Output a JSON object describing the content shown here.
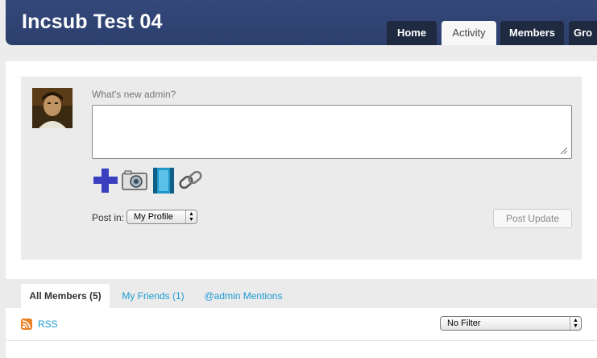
{
  "site": {
    "title": "Incsub Test 04"
  },
  "nav": {
    "tabs": [
      {
        "label": "Home"
      },
      {
        "label": "Activity"
      },
      {
        "label": "Members"
      },
      {
        "label": "Gro"
      }
    ],
    "active_tab": "Activity"
  },
  "whats_new": {
    "prompt": "What's new admin?",
    "textarea_value": "",
    "media_icons": [
      "add-icon",
      "camera-icon",
      "film-icon",
      "link-icon"
    ],
    "post_in_label": "Post in:",
    "post_in_selected": "My Profile",
    "submit_label": "Post Update"
  },
  "item_tabs": [
    {
      "label": "All Members (5)"
    },
    {
      "label": "My Friends (1)"
    },
    {
      "label": "@admin Mentions"
    }
  ],
  "filter": {
    "rss_label": "RSS",
    "selected": "No Filter"
  },
  "colors": {
    "header": "#34487a",
    "link": "#1e9bd3",
    "panel": "#ebebeb",
    "plus_icon": "#3a3fc0"
  }
}
